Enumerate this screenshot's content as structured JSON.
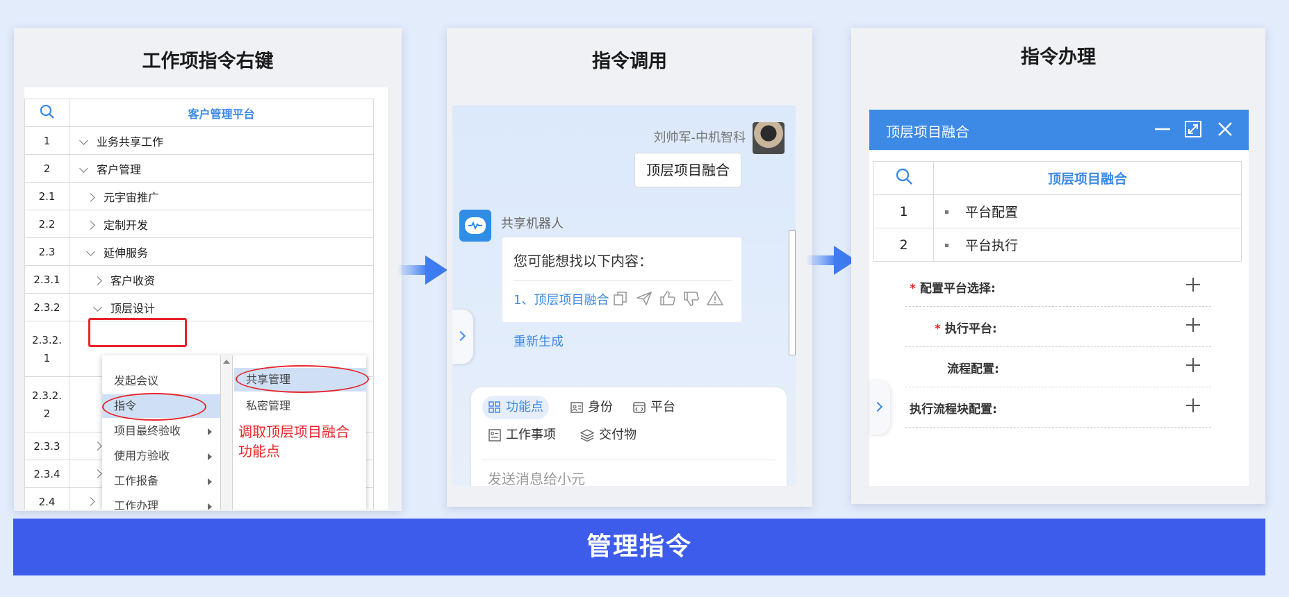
{
  "panel1": {
    "title": "工作项指令右键",
    "tree": {
      "header": "客户管理平台",
      "rows": [
        {
          "num": "1",
          "label": "业务共享工作"
        },
        {
          "num": "2",
          "label": "客户管理"
        },
        {
          "num": "2.1",
          "label": "元宇宙推广"
        },
        {
          "num": "2.2",
          "label": "定制开发"
        },
        {
          "num": "2.3",
          "label": "延伸服务"
        },
        {
          "num": "2.3.1",
          "label": "客户收资"
        },
        {
          "num": "2.3.2",
          "label": "顶层设计"
        },
        {
          "num_line1": "2.3.2.",
          "num_line2": "1"
        },
        {
          "num_line1": "2.3.2.",
          "num_line2": "2"
        },
        {
          "num": "2.3.3"
        },
        {
          "num": "2.3.4"
        },
        {
          "num": "2.4"
        }
      ]
    },
    "context_menu": {
      "items": [
        "发起会议",
        "指令",
        "项目最终验收",
        "使用方验收",
        "工作报备",
        "工作办理"
      ],
      "submenu": [
        "共享管理",
        "私密管理"
      ]
    },
    "annotation": {
      "line1": "调取顶层项目融合",
      "line2": "功能点"
    }
  },
  "panel2": {
    "title": "指令调用",
    "user_name": "刘帅军-中机智科",
    "user_message": "顶层项目融合",
    "bot_name": "共享机器人",
    "bot_message": "您可能想找以下内容：",
    "bot_link": "1、顶层项目融合",
    "regenerate": "重新生成",
    "chips": [
      "功能点",
      "身份",
      "平台",
      "工作事项",
      "交付物"
    ],
    "input_placeholder": "发送消息给小元"
  },
  "panel3": {
    "title": "指令办理",
    "dialog_title": "顶层项目融合",
    "table": {
      "header": "顶层项目融合",
      "rows": [
        {
          "num": "1",
          "label": "平台配置"
        },
        {
          "num": "2",
          "label": "平台执行"
        }
      ]
    },
    "form": [
      {
        "label": "配置平台选择:",
        "required": "*"
      },
      {
        "label": "执行平台:",
        "required": "*"
      },
      {
        "label": "流程配置:"
      },
      {
        "label": "执行流程块配置:"
      }
    ]
  },
  "banner": "管理指令",
  "colors": {
    "accent": "#3c8ae6",
    "banner": "#3d5ceb",
    "annotation": "#e8242a"
  }
}
